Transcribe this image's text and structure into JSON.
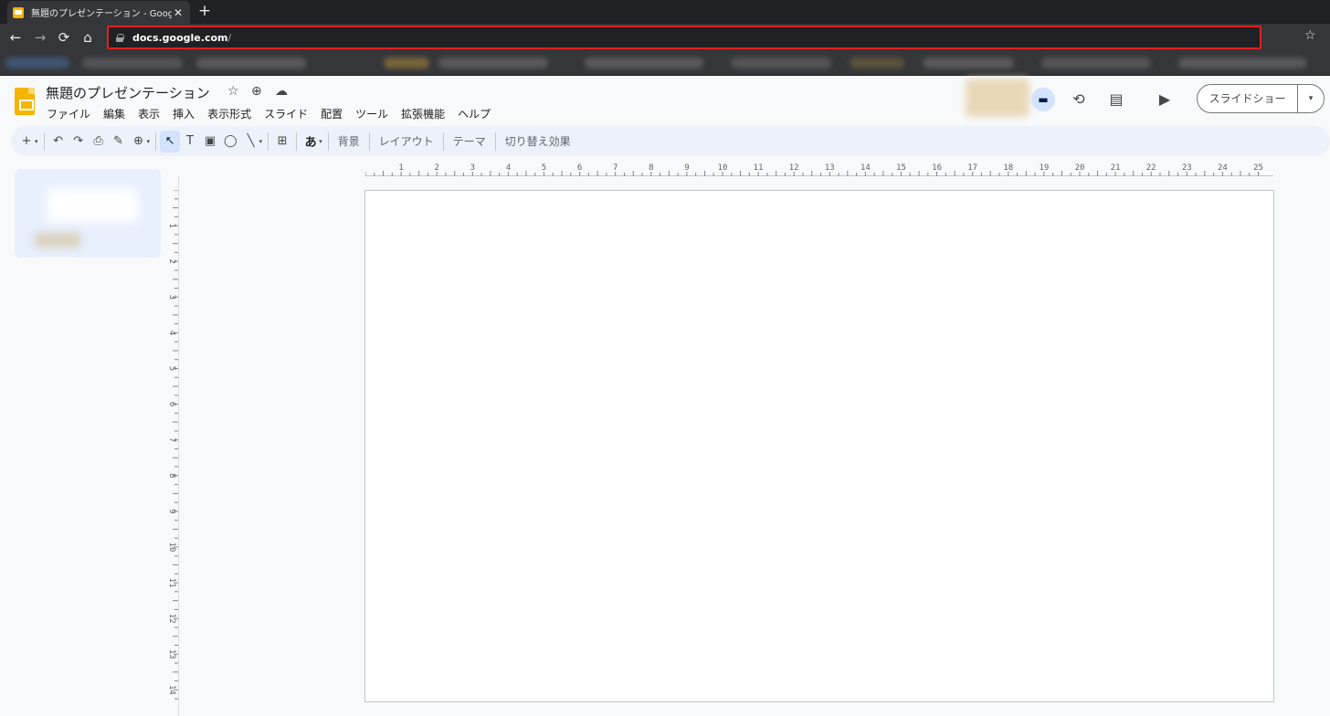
{
  "browser": {
    "tab_title": "無題のプレゼンテーション - Google スライド",
    "tab_close": "✕",
    "new_tab": "+",
    "url_host": "docs.google.com",
    "url_rest": "/",
    "back": "←",
    "forward": "→",
    "reload": "⟳",
    "home": "⌂",
    "bookmark_star": "☆"
  },
  "doc": {
    "title": "無題のプレゼンテーション",
    "star": "☆",
    "move": "⊕",
    "cloud": "☁"
  },
  "menu": [
    "ファイル",
    "編集",
    "表示",
    "挿入",
    "表示形式",
    "スライド",
    "配置",
    "ツール",
    "拡張機能",
    "ヘルプ"
  ],
  "header_actions": {
    "history": "⟲",
    "comments": "▤",
    "meet": "▶",
    "slideshow_label": "スライドショー",
    "slideshow_drop": "▾"
  },
  "toolbar": {
    "new": "+",
    "undo": "↶",
    "redo": "↷",
    "print": "⎙",
    "paint": "✎",
    "zoom": "⊕",
    "select": "↖",
    "textbox": "T",
    "image": "▣",
    "shape": "◯",
    "line": "╲",
    "comment": "⊞",
    "input": "あ",
    "background": "背景",
    "layout": "レイアウト",
    "theme": "テーマ",
    "transition": "切り替え効果",
    "drop": "▾"
  },
  "ruler": {
    "h_labels": [
      "1",
      "2",
      "3",
      "4",
      "5",
      "6",
      "7",
      "8",
      "9",
      "10",
      "11",
      "12",
      "13",
      "14",
      "15",
      "16",
      "17",
      "18",
      "19",
      "20",
      "21",
      "22",
      "23",
      "24",
      "25"
    ],
    "v_labels": [
      "1",
      "2",
      "3",
      "4",
      "5",
      "6",
      "7",
      "8",
      "9",
      "10",
      "11",
      "12",
      "13",
      "14"
    ]
  }
}
